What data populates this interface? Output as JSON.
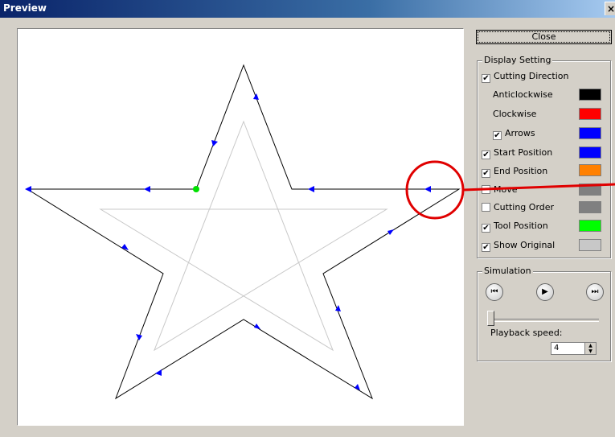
{
  "window": {
    "title": "Preview"
  },
  "close_button": "Close",
  "display_setting": {
    "title": "Display Setting",
    "cutting_direction": {
      "label": "Cutting Direction",
      "checked": true
    },
    "anticlockwise": {
      "label": "Anticlockwise",
      "color": "#000000"
    },
    "clockwise": {
      "label": "Clockwise",
      "color": "#ff0000"
    },
    "arrows": {
      "label": "Arrows",
      "checked": true,
      "color": "#0000ff"
    },
    "start_position": {
      "label": "Start Position",
      "checked": true,
      "color": "#0000ff"
    },
    "end_position": {
      "label": "End Position",
      "checked": true,
      "color": "#ff8000"
    },
    "move": {
      "label": "Move",
      "checked": false,
      "color": "#808080"
    },
    "cutting_order": {
      "label": "Cutting Order",
      "checked": false,
      "color": "#808080"
    },
    "tool_position": {
      "label": "Tool Position",
      "checked": true,
      "color": "#00ff00"
    },
    "show_original": {
      "label": "Show Original",
      "checked": true,
      "color": "#c8c8c8"
    }
  },
  "simulation": {
    "title": "Simulation",
    "playback_speed_label": "Playback speed:",
    "playback_speed_value": "4",
    "slider_value": 0
  },
  "check_glyph": "✔"
}
